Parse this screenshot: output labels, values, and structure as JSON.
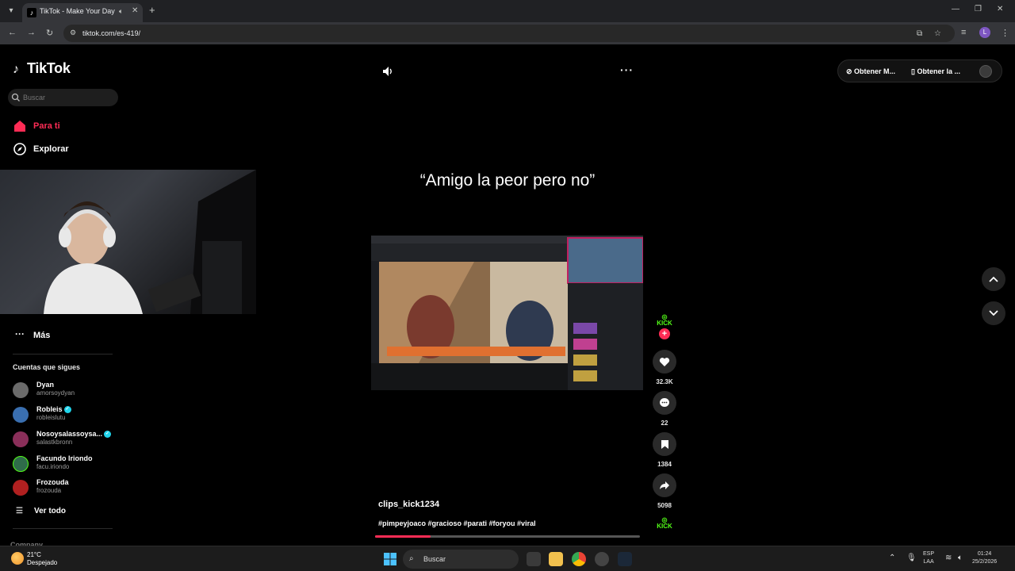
{
  "browser": {
    "tab_title": "TikTok - Make Your Day",
    "url": "tiktok.com/es-419/"
  },
  "sidebar": {
    "logo": "TikTok",
    "search_placeholder": "Buscar",
    "nav": [
      {
        "label": "Para ti",
        "active": true
      },
      {
        "label": "Explorar",
        "active": false
      },
      {
        "label": "Más",
        "active": false
      }
    ],
    "following_title": "Cuentas que sigues",
    "accounts": [
      {
        "name": "Dyan",
        "handle": "amorsoydyan",
        "verified": false,
        "color": "#6b6b6b"
      },
      {
        "name": "Robleis",
        "handle": "robleislutu",
        "verified": true,
        "color": "#3a6fb0"
      },
      {
        "name": "Nosoysalassoysa...",
        "handle": "salastkbronn",
        "verified": true,
        "color": "#8a2f5a"
      },
      {
        "name": "Facundo Iriondo",
        "handle": "facu.iriondo",
        "verified": false,
        "color": "#2f6b4a"
      },
      {
        "name": "Frozouda",
        "handle": "frozouda",
        "verified": false,
        "color": "#b02020"
      }
    ],
    "see_all": "Ver todo",
    "company": "Company"
  },
  "header": {
    "get_app_1": "Obtener M...",
    "get_app_2": "Obtener la ..."
  },
  "video": {
    "caption": "“Amigo la peor pero no”",
    "author": "clips_kick1234",
    "tags": "#pimpeyjoaco #gracioso #parati #foryou #viral",
    "progress": 0.21,
    "kick_label": "KICK",
    "likes": "32.3K",
    "comments": "22",
    "saves": "1384",
    "shares": "5098"
  },
  "taskbar": {
    "temp": "21°C",
    "weather": "Despejado",
    "search": "Buscar",
    "lang_1": "ESP",
    "lang_2": "LAA",
    "time": "01:24",
    "date": "25/2/2026"
  },
  "colors": {
    "accent": "#fe2c55",
    "kick_green": "#53fc18",
    "verified": "#20d5ec"
  }
}
